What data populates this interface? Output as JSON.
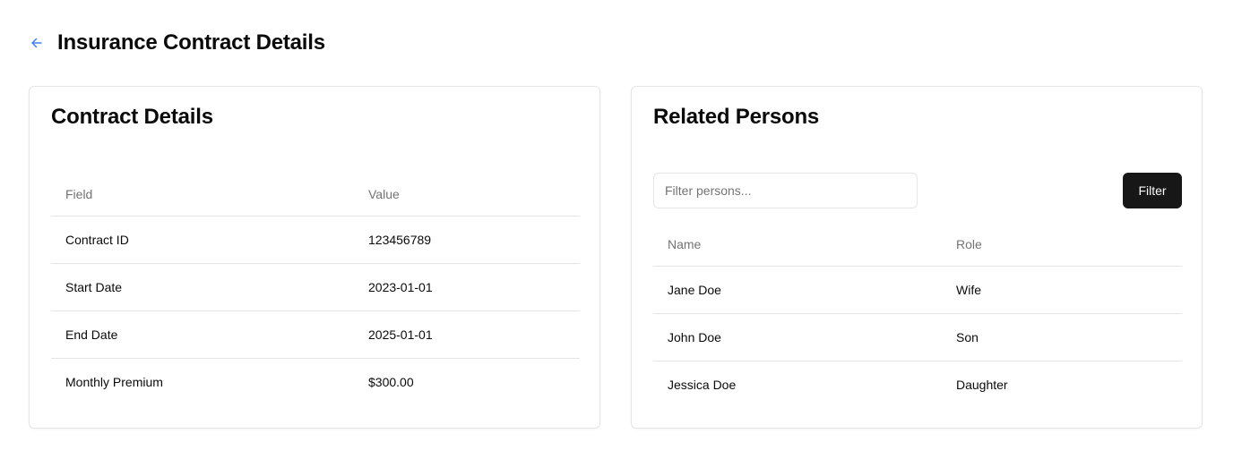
{
  "header": {
    "title": "Insurance Contract Details",
    "back_icon": "arrow-left-icon",
    "accent_color": "#3b82f6"
  },
  "contract_card": {
    "title": "Contract Details",
    "columns": [
      "Field",
      "Value"
    ],
    "rows": [
      {
        "field": "Contract ID",
        "value": "123456789"
      },
      {
        "field": "Start Date",
        "value": "2023-01-01"
      },
      {
        "field": "End Date",
        "value": "2025-01-01"
      },
      {
        "field": "Monthly Premium",
        "value": "$300.00"
      }
    ]
  },
  "persons_card": {
    "title": "Related Persons",
    "filter": {
      "placeholder": "Filter persons...",
      "value": "",
      "button_label": "Filter"
    },
    "columns": [
      "Name",
      "Role"
    ],
    "rows": [
      {
        "name": "Jane Doe",
        "role": "Wife"
      },
      {
        "name": "John Doe",
        "role": "Son"
      },
      {
        "name": "Jessica Doe",
        "role": "Daughter"
      }
    ]
  }
}
